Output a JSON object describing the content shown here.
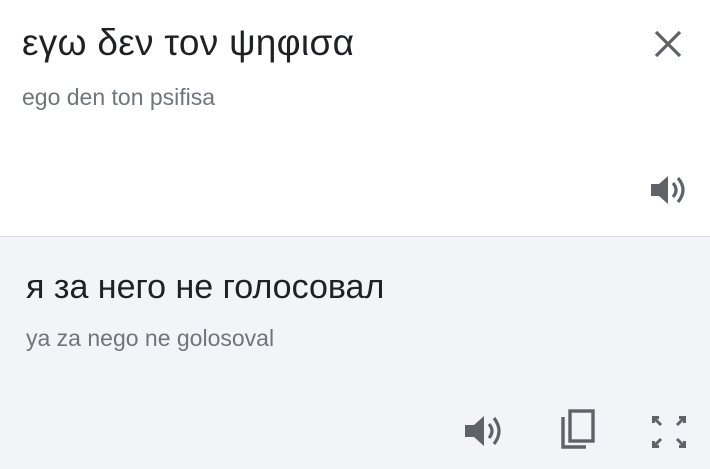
{
  "source": {
    "text": "εγω δεν τον ψηφισα",
    "transliteration": "ego den ton psifisa"
  },
  "target": {
    "text": "я за него не голосовал",
    "transliteration": "ya za nego ne golosoval"
  },
  "icons": {
    "close": "close-icon",
    "source_speaker": "speaker-icon",
    "target_speaker": "speaker-icon",
    "copy": "copy-icon",
    "fullscreen": "fullscreen-icon"
  },
  "colors": {
    "text_primary": "#202124",
    "text_secondary": "#70757a",
    "icon": "#5f6368",
    "target_background": "#f2f4f8",
    "divider": "#dadce0"
  }
}
